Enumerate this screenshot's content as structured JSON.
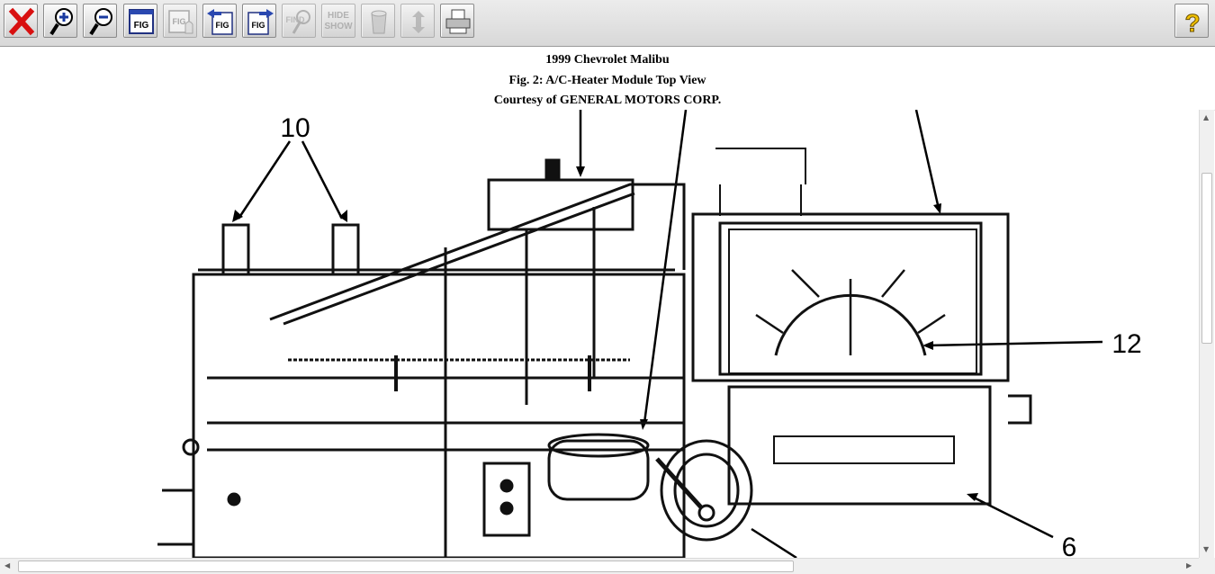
{
  "toolbar": {
    "buttons": [
      {
        "name": "close",
        "label": ""
      },
      {
        "name": "zoom-in",
        "label": ""
      },
      {
        "name": "zoom-out",
        "label": ""
      },
      {
        "name": "fig-window",
        "label": "FIG"
      },
      {
        "name": "fig-hand",
        "label": "FIG"
      },
      {
        "name": "fig-previous",
        "label": "FIG"
      },
      {
        "name": "fig-next",
        "label": "FIG"
      },
      {
        "name": "find",
        "label": "FIND"
      },
      {
        "name": "hide-show",
        "label_top": "HIDE",
        "label_bottom": "SHOW"
      },
      {
        "name": "trash",
        "label": ""
      },
      {
        "name": "rotate",
        "label": ""
      },
      {
        "name": "print",
        "label": ""
      },
      {
        "name": "help",
        "label": "?"
      }
    ]
  },
  "caption": {
    "vehicle": "1999 Chevrolet Malibu",
    "figure_title": "Fig. 2: A/C-Heater Module Top View",
    "courtesy": "Courtesy of GENERAL MOTORS CORP."
  },
  "figure": {
    "callouts": [
      "10",
      "12",
      "6"
    ]
  },
  "colors": {
    "close_red": "#d81010",
    "help_yellow": "#f2c200",
    "toolbar_bg": "#e2e2e2"
  }
}
